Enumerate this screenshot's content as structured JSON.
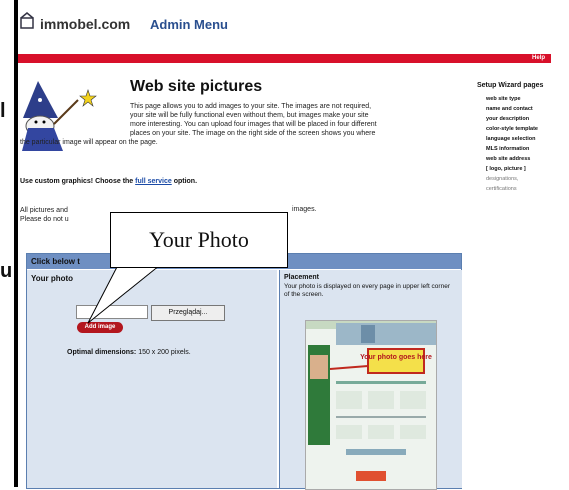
{
  "window": {
    "clipped_chars": [
      "l",
      "u"
    ]
  },
  "header": {
    "logo_text": "immobel.com",
    "admin_menu": "Admin Menu",
    "help_label": "Help",
    "brand_red": "#d8102a",
    "accent_blue": "#2a4f8f"
  },
  "intro": {
    "title": "Web site pictures",
    "lines": [
      "This page allows you to add images to your site. The images are not required,",
      "your site will be fully functional even without them, but images make your site",
      "more interesting. You can upload four images that will be placed in four different",
      "places on your site. The image on the right side of the screen shows you where"
    ],
    "last_line": "the particular image will appear on the page."
  },
  "custom_graphics": {
    "text": "Use custom graphics! Choose the",
    "link": "full service",
    "suffix": "option."
  },
  "all_pictures": {
    "line1": "All pictures and",
    "line2": "Please do not u",
    "tail": "images."
  },
  "sidebar": {
    "title": "Setup Wizard pages",
    "items": [
      {
        "label": "web site type"
      },
      {
        "label": "name and contact"
      },
      {
        "label": "your description"
      },
      {
        "label": "color-style template"
      },
      {
        "label": "language selection"
      },
      {
        "label": "MLS information"
      },
      {
        "label": "web site address"
      },
      {
        "label": "logo, picture"
      },
      {
        "label": "designations,"
      },
      {
        "label": "certifications"
      }
    ]
  },
  "panel": {
    "heading": "Click below t",
    "your_photo": "Your photo",
    "browse_label": "Przeglądaj...",
    "add_image_label": "Add image",
    "optimal_label": "Optimal dimensions:",
    "optimal_value": "150 x 200 pixels.",
    "placement_title": "Placement",
    "placement_desc": "Your photo is displayed on every page in upper left corner of the screen.",
    "thumb_callout": "Your photo goes here"
  },
  "callout": {
    "label": "Your Photo"
  }
}
